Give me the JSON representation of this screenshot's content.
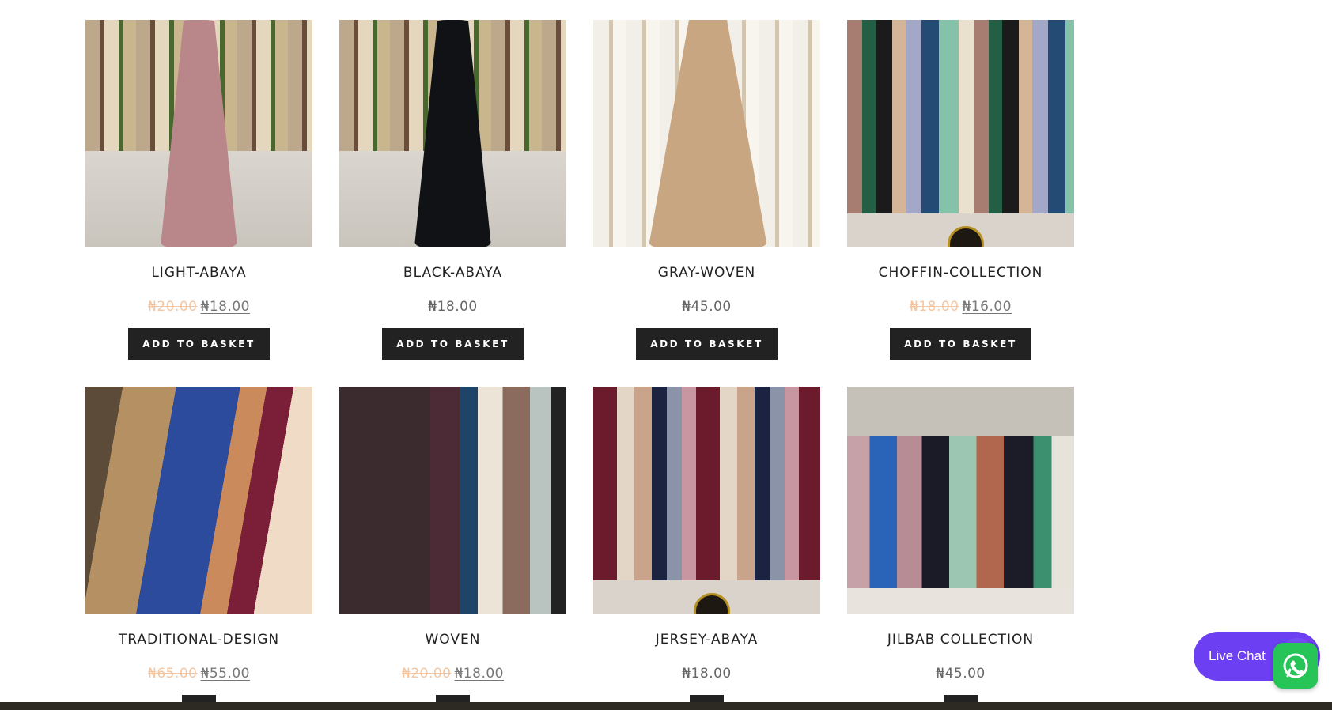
{
  "products": [
    {
      "name": "LIGHT-ABAYA",
      "old_price": "₦20.00",
      "price": "₦18.00",
      "on_sale": true,
      "button": "ADD TO BASKET",
      "image_alt": "light-abaya-image"
    },
    {
      "name": "BLACK-ABAYA",
      "old_price": "",
      "price": "₦18.00",
      "on_sale": false,
      "button": "ADD TO BASKET",
      "image_alt": "black-abaya-image"
    },
    {
      "name": "GRAY-WOVEN",
      "old_price": "",
      "price": "₦45.00",
      "on_sale": false,
      "button": "ADD TO BASKET",
      "image_alt": "gray-woven-image"
    },
    {
      "name": "CHOFFIN-COLLECTION",
      "old_price": "₦18.00",
      "price": "₦16.00",
      "on_sale": true,
      "button": "ADD TO BASKET",
      "image_alt": "choffin-collection-image"
    },
    {
      "name": "TRADITIONAL-DESIGN",
      "old_price": "₦65.00",
      "price": "₦55.00",
      "on_sale": true,
      "button": "",
      "image_alt": "traditional-design-image"
    },
    {
      "name": "WOVEN",
      "old_price": "₦20.00",
      "price": "₦18.00",
      "on_sale": true,
      "button": "",
      "image_alt": "woven-image"
    },
    {
      "name": "JERSEY-ABAYA",
      "old_price": "",
      "price": "₦18.00",
      "on_sale": false,
      "button": "",
      "image_alt": "jersey-abaya-image"
    },
    {
      "name": "JILBAB COLLECTION",
      "old_price": "",
      "price": "₦45.00",
      "on_sale": false,
      "button": "",
      "image_alt": "jilbab-collection-image"
    }
  ],
  "chat": {
    "label": "Live Chat",
    "whatsapp_icon": "whatsapp-icon"
  },
  "colors": {
    "button_bg": "#222222",
    "old_price": "#f4c7a2",
    "live_chat": "#6c3ff2",
    "whatsapp": "#27c457"
  }
}
